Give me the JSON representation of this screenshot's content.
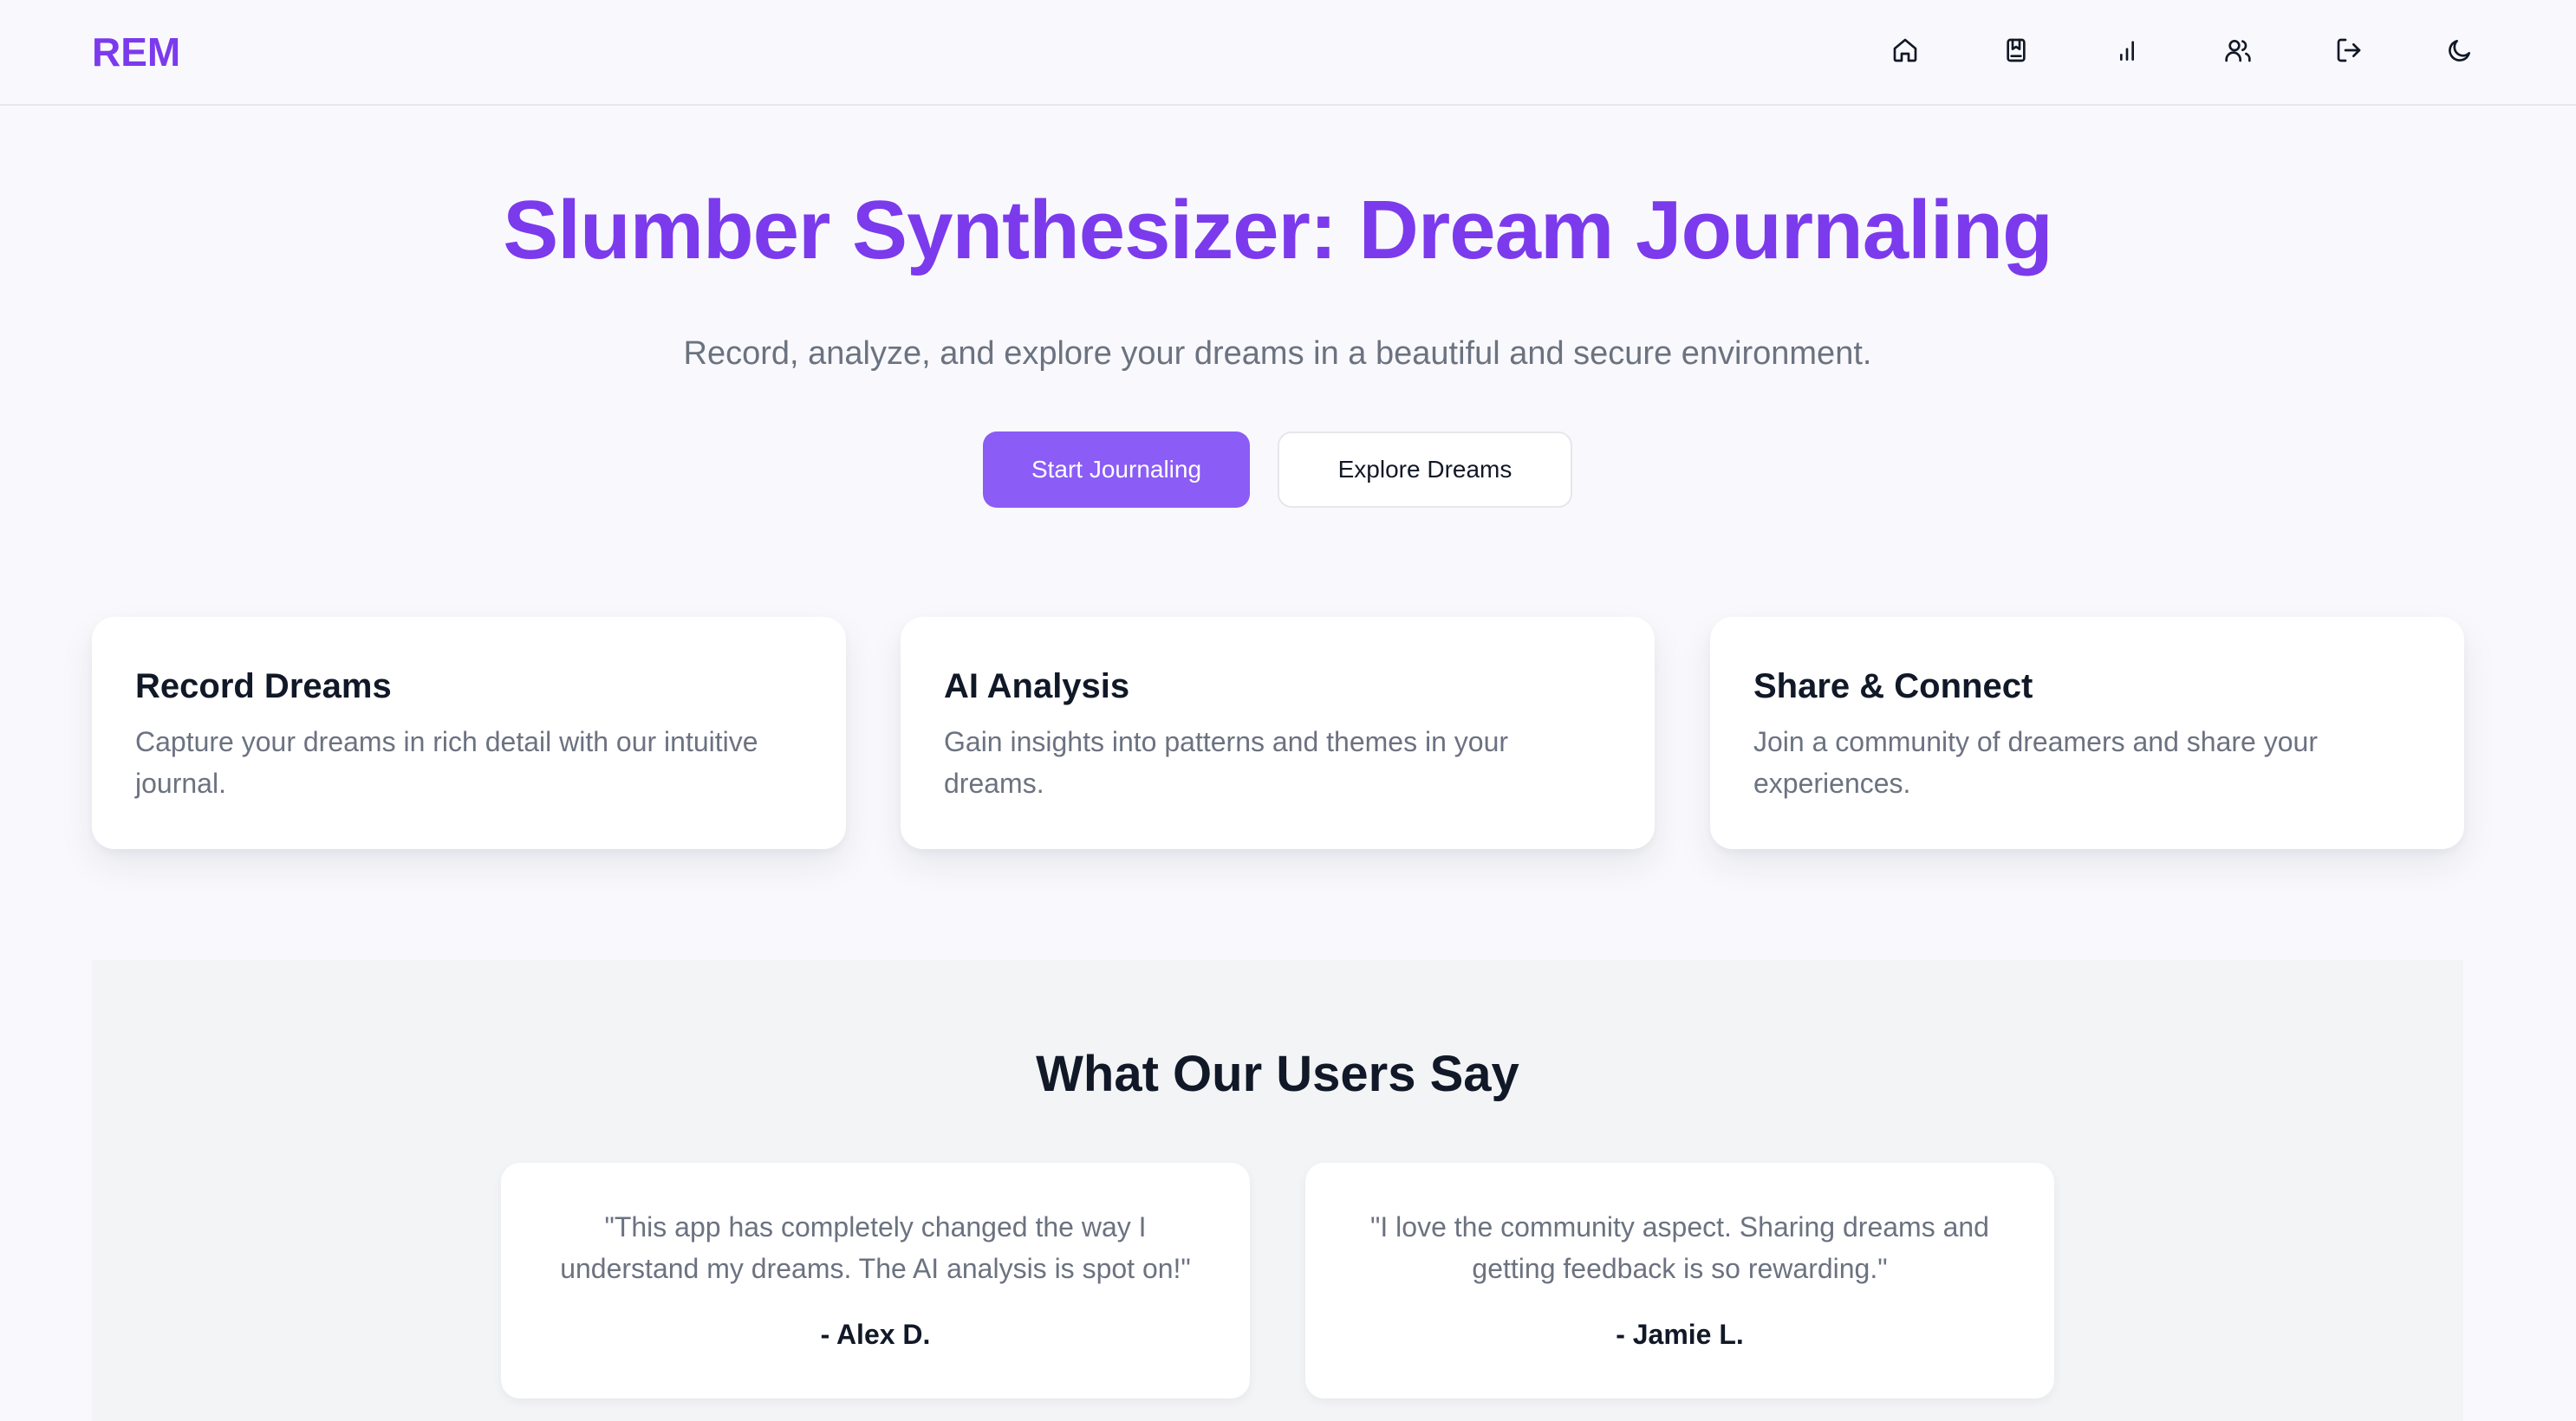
{
  "header": {
    "logo": "REM",
    "nav": [
      {
        "icon": "home-icon",
        "label": "Home"
      },
      {
        "icon": "journal-icon",
        "label": "Journal"
      },
      {
        "icon": "analytics-icon",
        "label": "Analytics"
      },
      {
        "icon": "community-icon",
        "label": "Community"
      },
      {
        "icon": "logout-icon",
        "label": "Log out"
      },
      {
        "icon": "moon-icon",
        "label": "Toggle theme"
      }
    ]
  },
  "hero": {
    "title": "Slumber Synthesizer: Dream Journaling",
    "subtitle": "Record, analyze, and explore your dreams in a beautiful and secure environment.",
    "primary_cta": "Start Journaling",
    "secondary_cta": "Explore Dreams"
  },
  "features": [
    {
      "title": "Record Dreams",
      "description": "Capture your dreams in rich detail with our intuitive journal."
    },
    {
      "title": "AI Analysis",
      "description": "Gain insights into patterns and themes in your dreams."
    },
    {
      "title": "Share & Connect",
      "description": "Join a community of dreamers and share your experiences."
    }
  ],
  "testimonials": {
    "heading": "What Our Users Say",
    "items": [
      {
        "quote": "\"This app has completely changed the way I understand my dreams. The AI analysis is spot on!\"",
        "author": "- Alex D."
      },
      {
        "quote": "\"I love the community aspect. Sharing dreams and getting feedback is so rewarding.\"",
        "author": "- Jamie L."
      }
    ]
  },
  "colors": {
    "brand": "#7c3aed",
    "primary_button": "#8b5cf6",
    "muted_text": "#6b7280",
    "background": "#f9f9fd",
    "section_background": "#f3f4f6"
  }
}
